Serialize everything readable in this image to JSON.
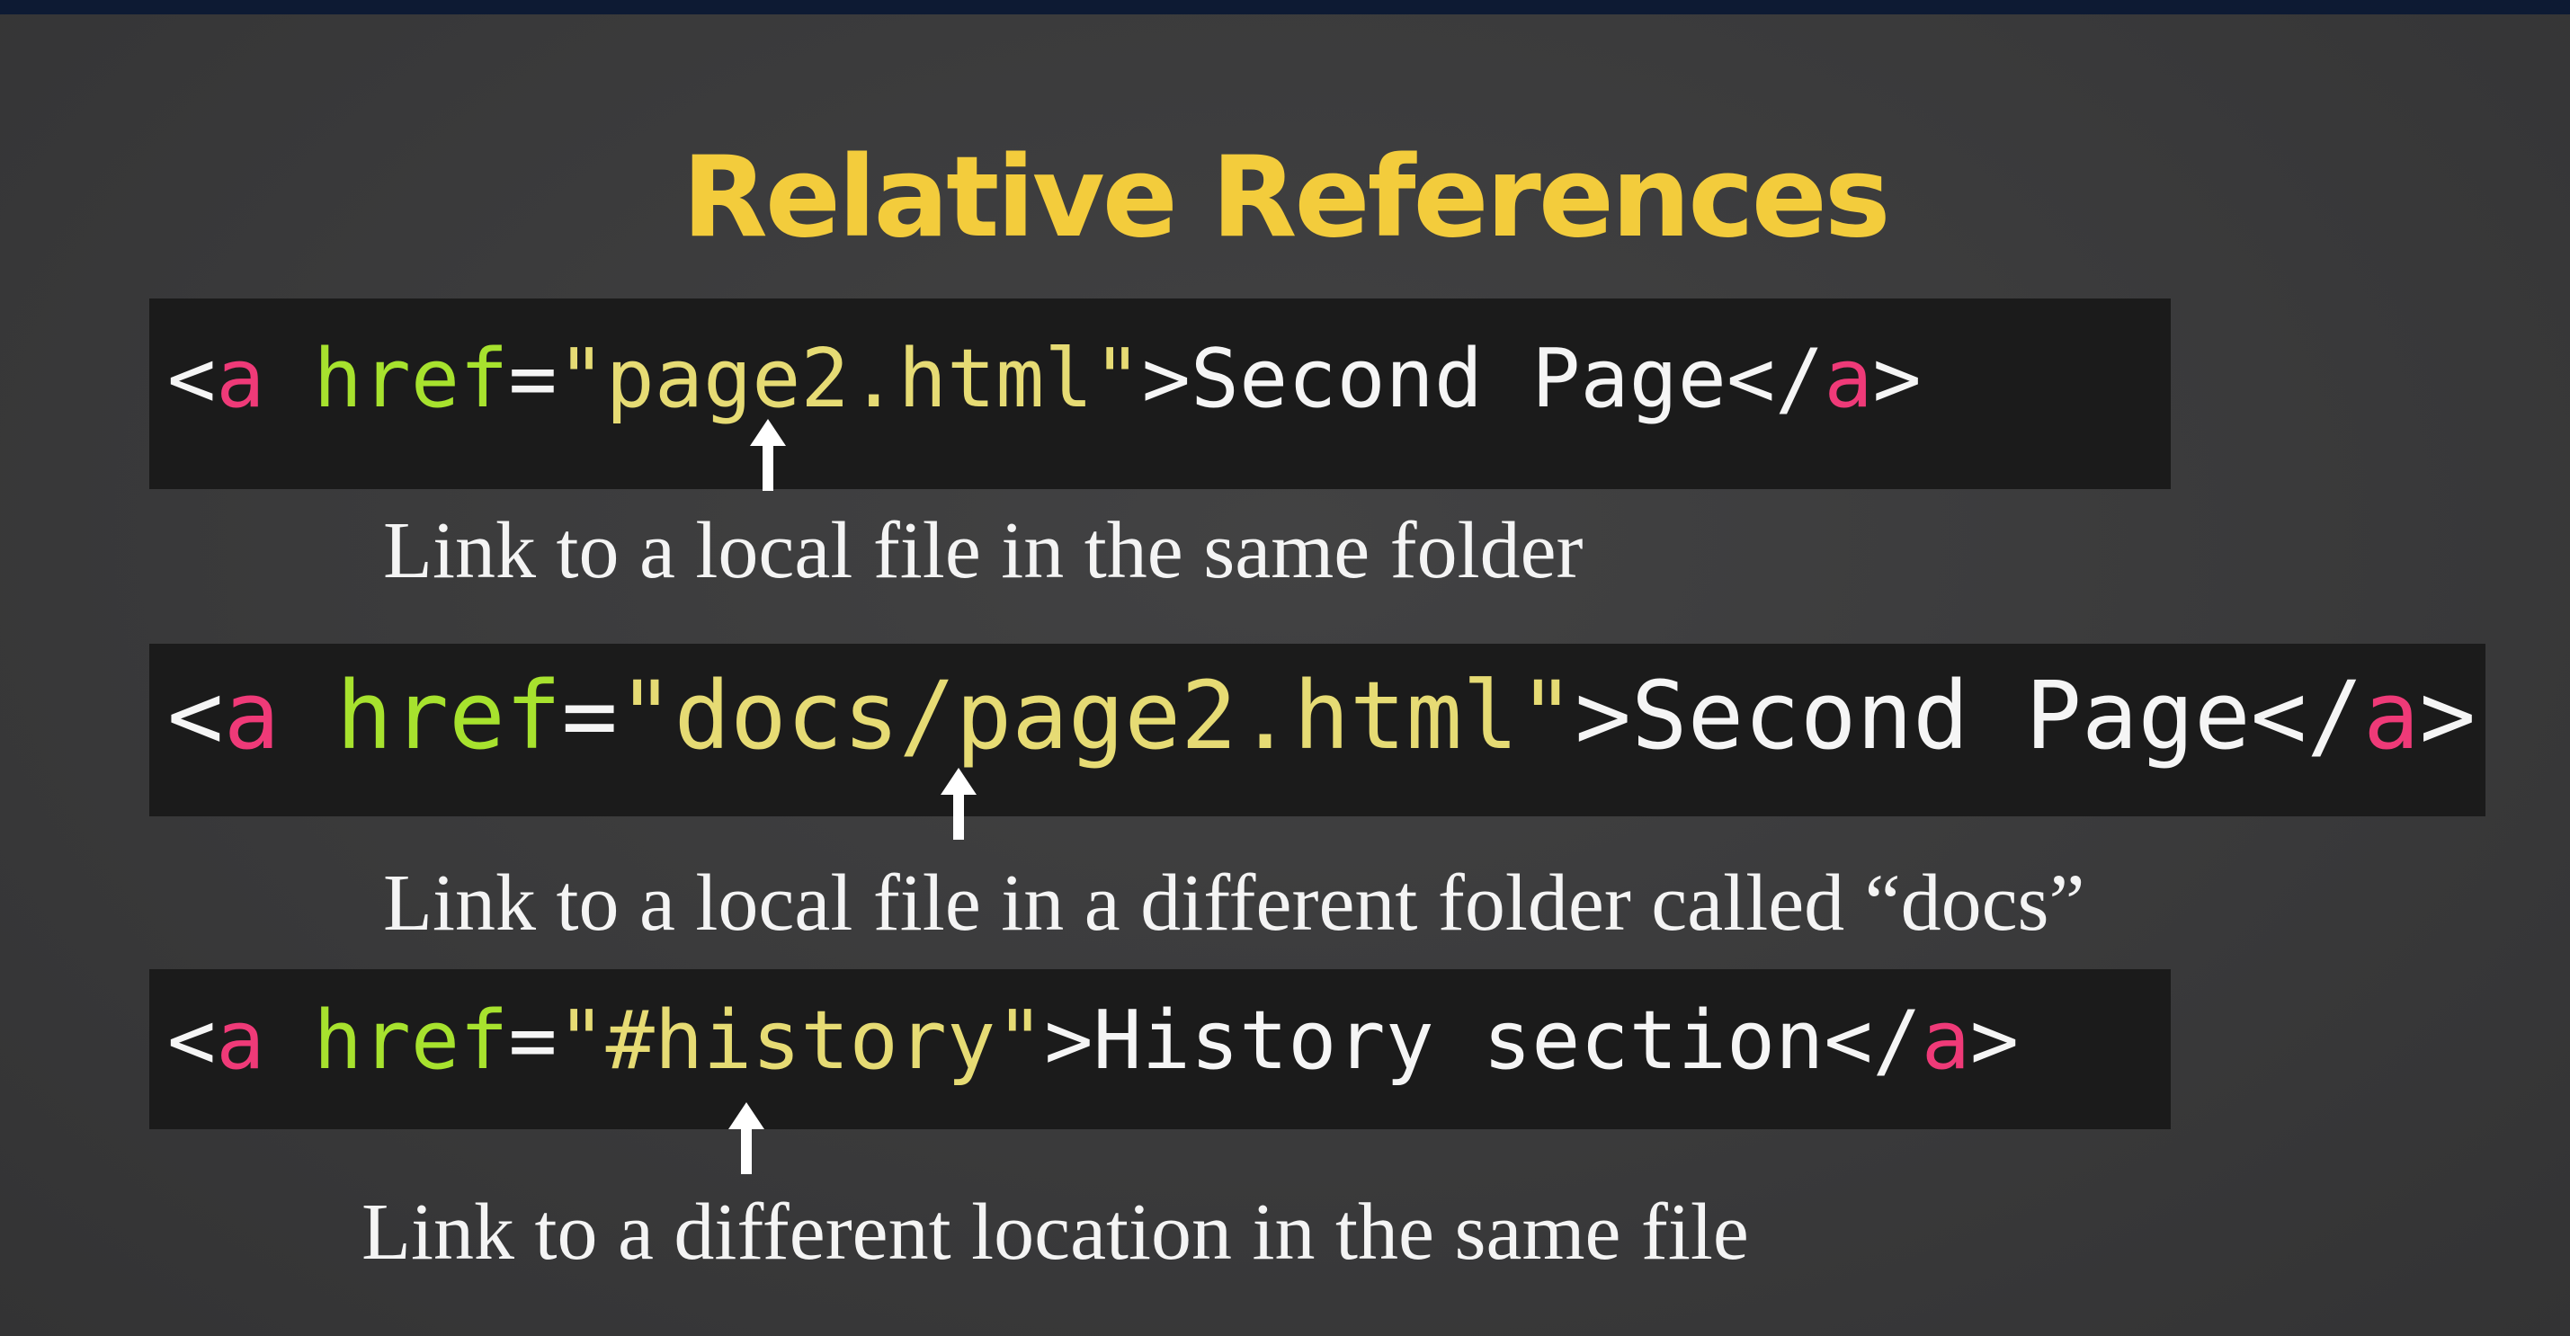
{
  "slide": {
    "title": "Relative References"
  },
  "examples": [
    {
      "code": {
        "open_bracket": "<",
        "tag": "a",
        "attr": "href",
        "equals": "=",
        "value": "\"page2.html\"",
        "close_bracket": ">",
        "text": "Second Page",
        "end_open": "</",
        "end_tag": "a",
        "end_close": ">"
      },
      "caption": "Link to a local file in the same folder"
    },
    {
      "code": {
        "open_bracket": "<",
        "tag": "a",
        "attr": "href",
        "equals": "=",
        "value": "\"docs/page2.html\"",
        "close_bracket": ">",
        "text": "Second Page",
        "end_open": "</",
        "end_tag": "a",
        "end_close": ">"
      },
      "caption": "Link to a local file in a different folder called “docs”"
    },
    {
      "code": {
        "open_bracket": "<",
        "tag": "a",
        "attr": "href",
        "equals": "=",
        "value": "\"#history\"",
        "close_bracket": ">",
        "text": "History section",
        "end_open": "</",
        "end_tag": "a",
        "end_close": ">"
      },
      "caption": "Link to a different location in the same file"
    }
  ],
  "colors": {
    "background": "#3a3a3b",
    "title": "#f3cc3c",
    "code_background": "#1b1b1b",
    "tag": "#ef3a78",
    "attribute": "#a7e22e",
    "string": "#e6db74",
    "text": "#f5f5f5"
  },
  "icons": [
    "up-arrow-icon"
  ]
}
